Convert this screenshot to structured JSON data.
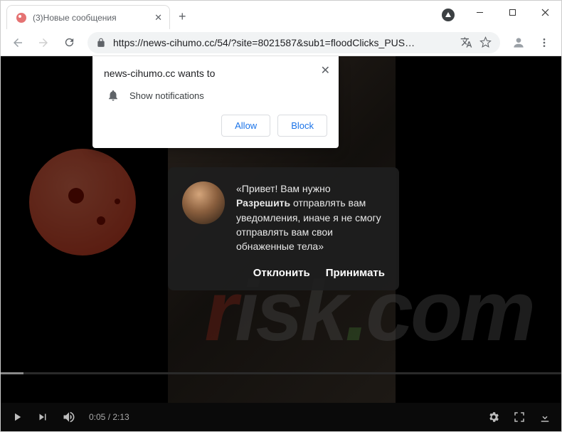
{
  "tab": {
    "title": "(3)Новые сообщения"
  },
  "url": {
    "display": "https://news-cihumo.cc/54/?site=8021587&sub1=floodClicks_PUS…"
  },
  "notification": {
    "origin": "news-cihumo.cc wants to",
    "permission_label": "Show notifications",
    "allow": "Allow",
    "block": "Block"
  },
  "overlay": {
    "line1": "«Привет! Вам нужно ",
    "bold": "Разрешить",
    "line2": " отправлять вам уведомления, иначе я не смогу отправлять вам свои обнаженные тела»",
    "decline": "Отклонить",
    "accept": "Принимать"
  },
  "player": {
    "current": "0:05",
    "sep": " / ",
    "total": "2:13"
  },
  "watermark": {
    "text_prefix": "r",
    "text_rest": "isk",
    "dot": ".",
    "tld": "com"
  }
}
